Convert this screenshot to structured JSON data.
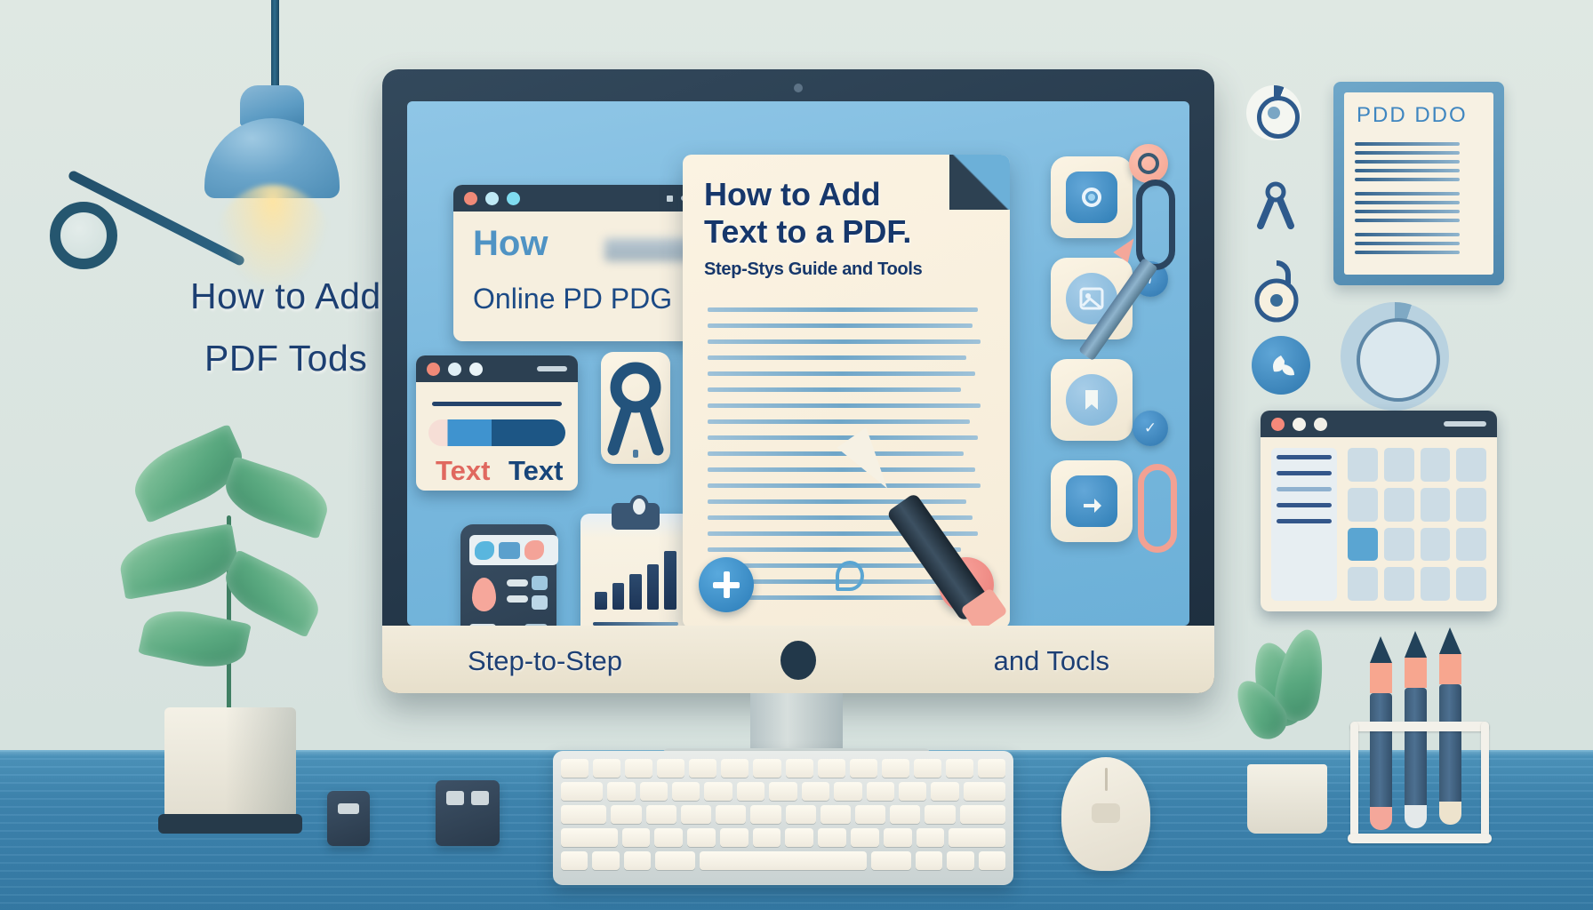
{
  "scene": {
    "title": "How to Add Text to a PDF - illustrated desk workspace",
    "wall_color": "#dde7e2",
    "desk_color": "#4f97bf",
    "screen_color": "#7bb9de",
    "accent_blue": "#2f7eb6",
    "accent_navy": "#16376b",
    "accent_pink": "#ea7e78",
    "paper_color": "#f6efdf"
  },
  "wall_text": {
    "line1": "How to Add",
    "line2": "PDF Tods"
  },
  "monitor": {
    "bezel_left_label": "Step-to-Step",
    "bezel_right_label": "and Tocls",
    "camera_icon": "webcam-dot",
    "power_icon": "power-button"
  },
  "browser_window_1": {
    "dots": [
      "#f08a78",
      "#bfe9f5",
      "#7fdcf0"
    ],
    "heading": "How",
    "subheading": "Online PD PDG",
    "menu_icon": "hamburger-icon"
  },
  "browser_window_2": {
    "dots": [
      "#f08a78",
      "#dfeef5",
      "#eaf4f8"
    ],
    "label_1": "Text",
    "label_2": "Text",
    "label_1_color": "#e0685f",
    "label_2_color": "#17457a",
    "pill_icon": "text-style-pill"
  },
  "grid_window": {
    "dots": [
      "#f5897a",
      "#f4f2ea",
      "#f0eee6"
    ],
    "menu_icon": "hamburger-icon",
    "sidebar_rows": 5,
    "grid_rows": 4,
    "grid_cols": 4,
    "highlighted_cell_index": 8
  },
  "document": {
    "title_line_1": "How to Add",
    "title_line_2": "Text to a PDF.",
    "subtitle": "Step-Stys Guide and Tools",
    "body_line_count": 19,
    "add_button_icon": "plus-icon",
    "add_button_label": "+",
    "delete_button_icon": "eyes-icon",
    "middle_icon": "droplet-icon",
    "corner_fold_icon": "page-fold"
  },
  "toolbar": {
    "buttons": [
      {
        "name": "settings-gear",
        "icon": "gear-icon",
        "glyph": "⚙"
      },
      {
        "name": "insert-image",
        "icon": "image-icon",
        "glyph": "◰"
      },
      {
        "name": "bookmark-page",
        "icon": "bookmark-icon",
        "glyph": "❖"
      },
      {
        "name": "share-export",
        "icon": "share-icon",
        "glyph": "⤒"
      }
    ],
    "badges": [
      {
        "name": "notification-badge",
        "color": "#f5a491",
        "glyph": "●"
      },
      {
        "name": "info-badge",
        "color": "#2f76ae",
        "glyph": "i"
      },
      {
        "name": "verified-badge",
        "color": "#2f76ae",
        "glyph": "✓"
      }
    ],
    "paperclip_icon": "paperclip-icon",
    "pencil_icon": "pencil-icon",
    "pen_icon": "fountain-pen-icon"
  },
  "desk_widgets": {
    "calculator_icon": "calculator-widget",
    "clipboard_icon": "clipboard-chart",
    "scissors_icon": "scissors-icon",
    "chart_bars": [
      28,
      42,
      55,
      72,
      92
    ]
  },
  "wall_icons": [
    {
      "name": "gear-icon-small",
      "glyph": "⚙"
    },
    {
      "name": "compass-icon",
      "glyph": "⋀"
    },
    {
      "name": "padlock-icon",
      "glyph": "⚿"
    },
    {
      "name": "leaf-badge-icon",
      "glyph": "❦"
    },
    {
      "name": "gear-icon-large",
      "glyph": "⚙"
    }
  ],
  "poster": {
    "title": "PDD DDO",
    "line_count": 12,
    "frame_color": "#4e87ad"
  },
  "peripherals": {
    "keyboard_icon": "keyboard",
    "keyboard_rows": 5,
    "mouse_icon": "mouse",
    "small_device_1": "usb-hub",
    "small_device_2": "external-drive",
    "pen_holder_icon": "pen-rack",
    "pen_count": 3,
    "plant_left_icon": "potted-plant",
    "plant_right_icon": "potted-plant-small",
    "lamp_icon": "desk-lamp"
  }
}
